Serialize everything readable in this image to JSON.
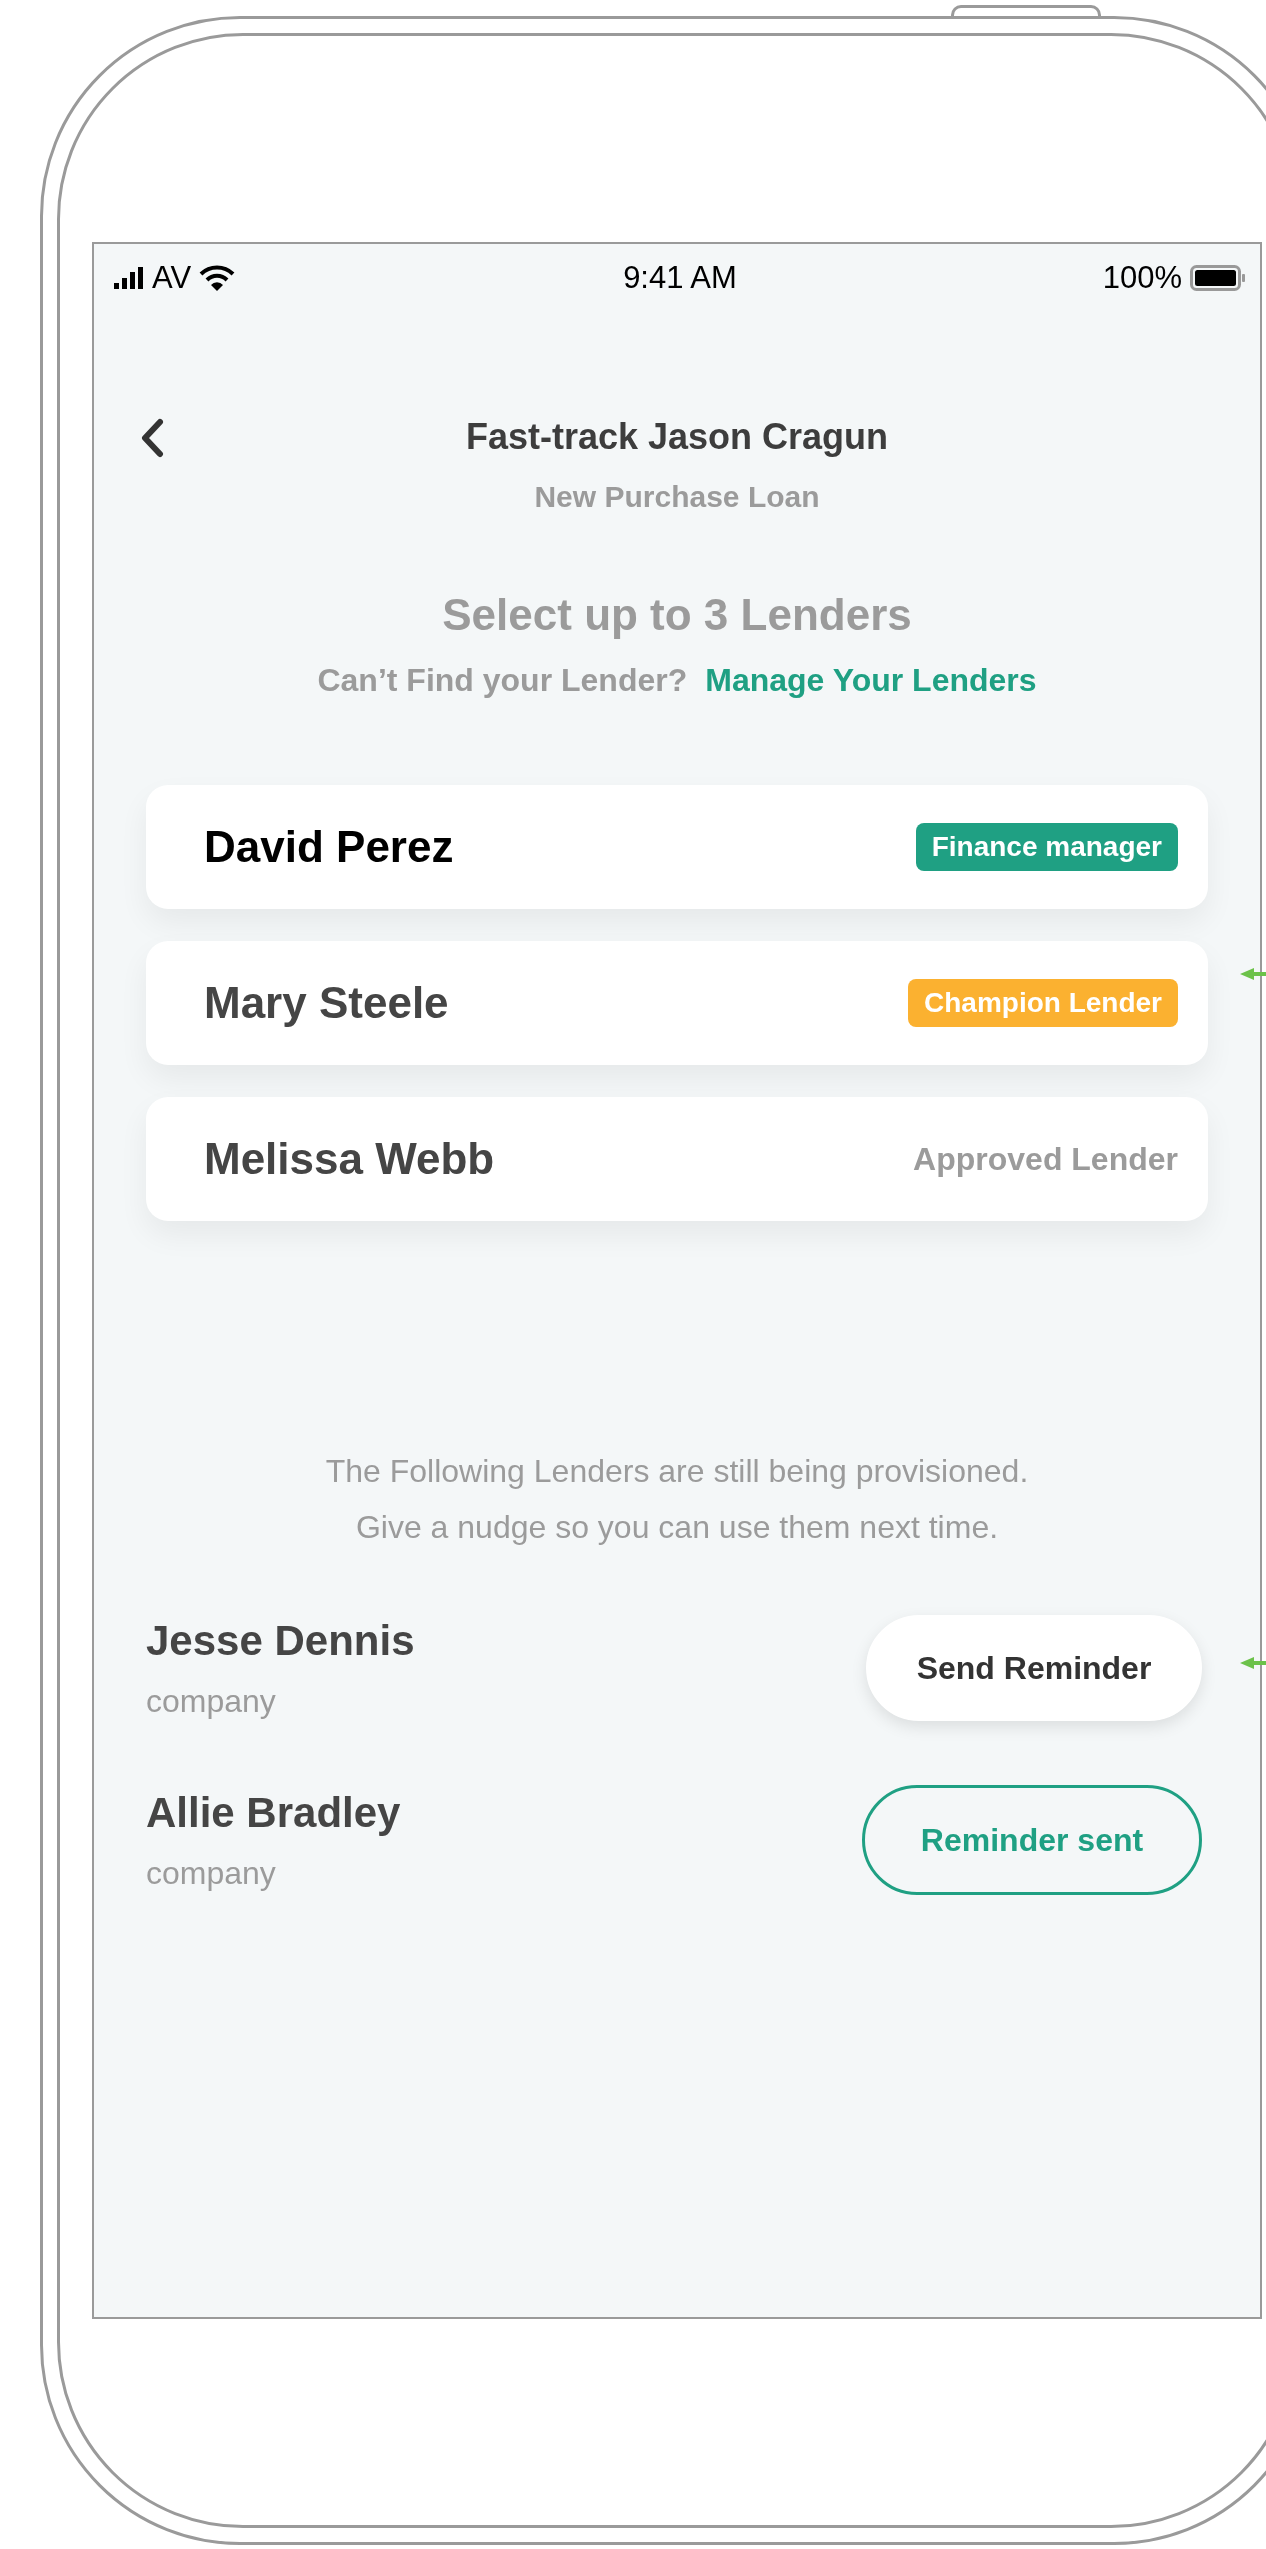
{
  "status_bar": {
    "carrier": "AV",
    "time": "9:41 AM",
    "battery": "100%"
  },
  "header": {
    "title": "Fast-track Jason Cragun",
    "subtitle": "New Purchase Loan"
  },
  "selection": {
    "heading": "Select up to 3 Lenders",
    "prompt": "Can’t Find your Lender?",
    "link": "Manage Your Lenders"
  },
  "lenders": [
    {
      "name": "David Perez",
      "role": "Finance manager",
      "kind": "badge",
      "color": "#1fa083",
      "selected": true
    },
    {
      "name": "Mary Steele",
      "role": "Champion Lender",
      "kind": "badge",
      "color": "#fbb130",
      "selected": false
    },
    {
      "name": "Melissa Webb",
      "role": "Approved Lender",
      "kind": "plain",
      "selected": false
    }
  ],
  "provisioning": {
    "message_lines": [
      "The Following Lenders are still being provisioned.",
      "Give a nudge so you can use them next time."
    ],
    "pending": [
      {
        "name": "Jesse Dennis",
        "company": "company",
        "action": "Send Reminder",
        "sent": false
      },
      {
        "name": "Allie Bradley",
        "company": "company",
        "action": "Reminder sent",
        "sent": true
      }
    ]
  }
}
